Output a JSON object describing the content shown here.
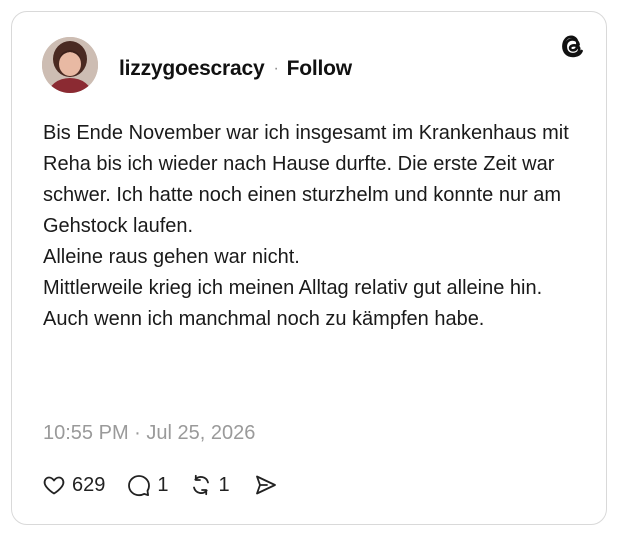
{
  "post": {
    "username": "lizzygoescracy",
    "separator": "·",
    "follow_label": "Follow",
    "text_lines": [
      "Bis Ende November war ich insgesamt im Krankenhaus mit Reha bis ich wieder nach Hause durfte. Die erste Zeit war schwer. Ich hatte noch einen sturzhelm und konnte nur am Gehstock laufen.",
      "Alleine raus gehen war nicht.",
      "Mittlerweile krieg ich meinen Alltag relativ gut alleine hin. Auch wenn ich manchmal noch zu kämpfen habe."
    ],
    "timestamp": "10:55 PM · Jul 25, 2026"
  },
  "actions": {
    "likes": "629",
    "replies": "1",
    "reposts": "1"
  },
  "icons": {
    "brand": "threads-logo-icon",
    "like": "heart-icon",
    "reply": "speech-bubble-icon",
    "repost": "repost-icon",
    "share": "send-icon"
  },
  "colors": {
    "text": "#111111",
    "muted": "#9a9a9a",
    "border": "#d9d9d9"
  }
}
